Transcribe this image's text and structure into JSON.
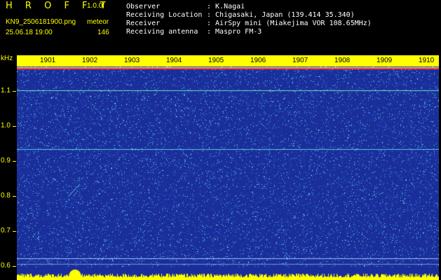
{
  "header": {
    "app_title": "H R O F F T",
    "version": "1.0.0f",
    "filename": "KN9_2506181900.png",
    "mode": "meteor",
    "datetime": "25.06.18 19:00",
    "count": "146"
  },
  "station_info": [
    {
      "label": "Observer",
      "value": ": K.Nagai"
    },
    {
      "label": "Receiving Location",
      "value": ": Chigasaki, Japan (139.414 35.340)"
    },
    {
      "label": "Receiver",
      "value": ": AirSpy mini (Miakejima VOR 108.65MHz)"
    },
    {
      "label": "Receiving antenna",
      "value": ": Maspro FM-3"
    }
  ],
  "time_axis": {
    "labels": [
      "1901",
      "1902",
      "1903",
      "1904",
      "1905",
      "1906",
      "1907",
      "1908",
      "1909",
      "1910"
    ]
  },
  "freq_axis": {
    "unit": "kHz",
    "labels": [
      "1.1",
      "1.0",
      "0.9",
      "0.8",
      "0.7",
      "0.6"
    ]
  },
  "colors": {
    "background": "#000000",
    "spectrogram_bg": "#1a2e9a",
    "header_yellow": "#ffff00",
    "reference_line": "#ff3c3c"
  }
}
